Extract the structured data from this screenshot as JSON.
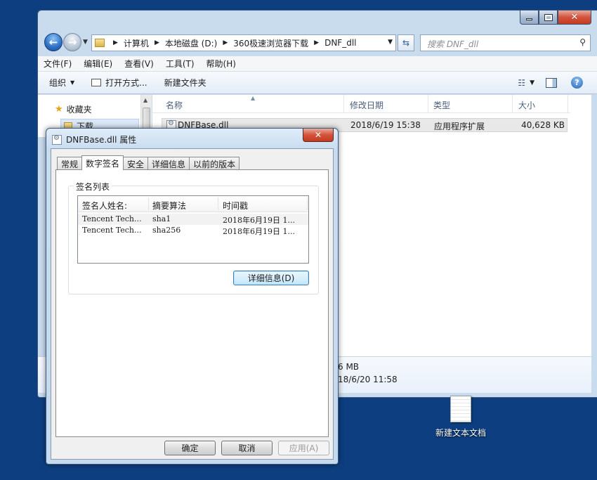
{
  "explorer": {
    "breadcrumb": [
      "计算机",
      "本地磁盘 (D:)",
      "360极速浏览器下载",
      "DNF_dll"
    ],
    "search_placeholder": "搜索 DNF_dll",
    "menu": [
      "文件(F)",
      "编辑(E)",
      "查看(V)",
      "工具(T)",
      "帮助(H)"
    ],
    "toolbar": {
      "organize": "组织",
      "open_with": "打开方式...",
      "new_folder": "新建文件夹"
    },
    "nav": {
      "favorites": "收藏夹",
      "downloads": "下载"
    },
    "columns": {
      "name": "名称",
      "modified": "修改日期",
      "type": "类型",
      "size": "大小"
    },
    "file": {
      "name": "DNFBase.dll",
      "modified": "2018/6/19 15:38",
      "type": "应用程序扩展",
      "size": "40,628 KB"
    },
    "details": {
      "line1": "6 MB",
      "line2": "18/6/20 11:58"
    }
  },
  "desktop": {
    "icon_label": "新建文本文档"
  },
  "dialog": {
    "title": "DNFBase.dll 属性",
    "tabs": [
      "常规",
      "数字签名",
      "安全",
      "详细信息",
      "以前的版本"
    ],
    "active_tab": "数字签名",
    "group_label": "签名列表",
    "list_headers": [
      "签名人姓名:",
      "摘要算法",
      "时间戳"
    ],
    "signatures": [
      {
        "signer": "Tencent Tech...",
        "digest": "sha1",
        "timestamp": "2018年6月19日 1..."
      },
      {
        "signer": "Tencent Tech...",
        "digest": "sha256",
        "timestamp": "2018年6月19日 1..."
      }
    ],
    "details_button": "详细信息(D)",
    "ok": "确定",
    "cancel": "取消",
    "apply": "应用(A)"
  }
}
